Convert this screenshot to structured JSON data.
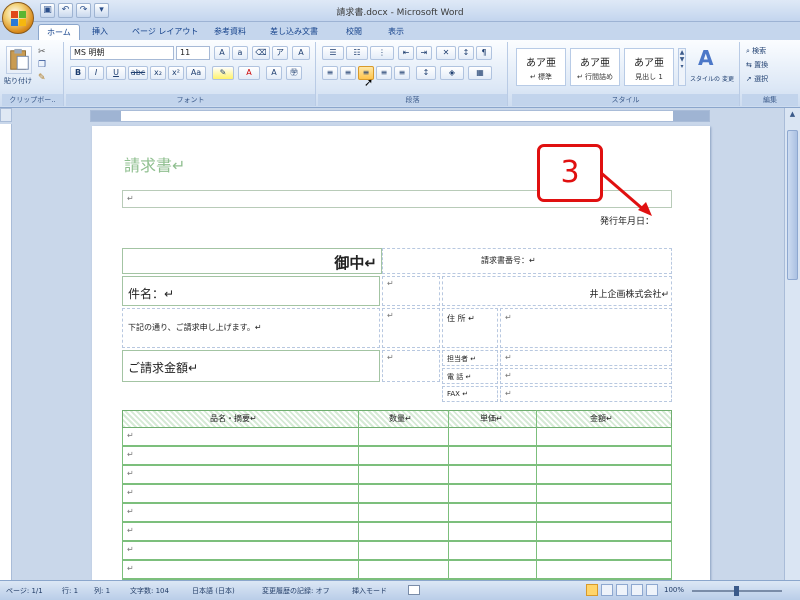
{
  "window": {
    "title": "請求書.docx - Microsoft Word"
  },
  "quick_access": [
    "save-icon",
    "undo-icon",
    "redo-icon",
    "customize-icon"
  ],
  "tabs": [
    "ホーム",
    "挿入",
    "ページ レイアウト",
    "参考資料",
    "差し込み文書",
    "校閲",
    "表示"
  ],
  "ribbon": {
    "clipboard": {
      "paste_label": "貼り付け",
      "group_label": "クリップボー.."
    },
    "font": {
      "name": "MS 明朝",
      "size": "11",
      "group_label": "フォント"
    },
    "paragraph": {
      "group_label": "段落"
    },
    "styles": {
      "items": [
        {
          "sample": "あア亜",
          "label": "↵ 標準"
        },
        {
          "sample": "あア亜",
          "label": "↵ 行間詰め"
        },
        {
          "sample": "あア亜",
          "label": "見出し 1"
        }
      ],
      "change_label": "スタイルの 変更",
      "group_label": "スタイル"
    },
    "editing": {
      "find": "検索",
      "replace": "置換",
      "select": "選択",
      "group_label": "編集"
    }
  },
  "document": {
    "title": "請求書↵",
    "issue_date": "発行年月日：",
    "to": "御中↵",
    "invoice_no": "請求書番号：↵",
    "subject": "件名：↵",
    "company": "井上企画株式会社↵",
    "note": "下記の通り、ご請求申し上げます。↵",
    "address": "住 所 ↵",
    "amount_label": "ご請求金額↵",
    "person": "担当者 ↵",
    "tel": "電 話 ↵",
    "fax": "FAX ↵",
    "table_headers": [
      "品名・摘要↵",
      "数量↵",
      "単価↵",
      "金額↵"
    ],
    "return_mark": "↵"
  },
  "callout": {
    "number": "3"
  },
  "status": {
    "page": "ページ: 1/1",
    "line": "行: 1",
    "column": "列: 1",
    "chars": "文字数: 104",
    "language": "日本語 (日本)",
    "track": "変更履歴の記録: オフ",
    "mode": "挿入モード",
    "zoom": "100%"
  }
}
